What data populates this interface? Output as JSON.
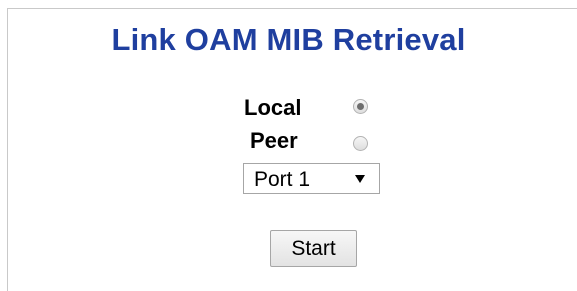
{
  "page": {
    "title": "Link OAM MIB Retrieval"
  },
  "form": {
    "options": [
      {
        "label": "Local",
        "checked": true
      },
      {
        "label": "Peer",
        "checked": false
      }
    ],
    "port_select": {
      "selected": "Port 1"
    },
    "start_label": "Start"
  }
}
